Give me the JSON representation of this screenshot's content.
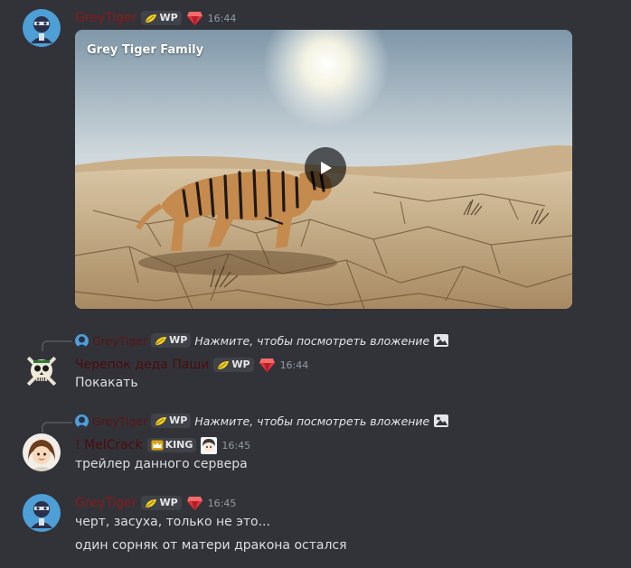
{
  "messages": [
    {
      "author": "GreyTiger",
      "tag": "WP",
      "time": "16:44",
      "video": {
        "title": "Grey Tiger Family"
      }
    },
    {
      "reply": {
        "author": "GreyTiger",
        "tag": "WP",
        "text": "Нажмите, чтобы посмотреть вложение"
      },
      "author": "Черепок деда Паши",
      "tag": "WP",
      "time": "16:44",
      "lines": [
        "Покакать"
      ]
    },
    {
      "reply": {
        "author": "GreyTiger",
        "tag": "WP",
        "text": "Нажмите, чтобы посмотреть вложение"
      },
      "author": "! MelCrack",
      "tag": "KING",
      "time": "16:45",
      "lines": [
        "трейлер данного сервера"
      ]
    },
    {
      "author": "GreyTiger",
      "tag": "WP",
      "time": "16:45",
      "lines": [
        "черт, засуха, только не это...",
        "один сорняк от матери дракона остался"
      ]
    }
  ],
  "icons": {
    "leaf": "leaf-icon",
    "gem": "red-gem-icon",
    "crown": "crown-icon",
    "image": "image-icon",
    "play": "play-icon"
  },
  "colors": {
    "background": "#323339",
    "name_red": "#8a1a1a",
    "gem_red": "#e0323c",
    "leaf_yellow": "#f5d21e",
    "text": "#dbdee1",
    "timestamp": "#949ba4"
  }
}
